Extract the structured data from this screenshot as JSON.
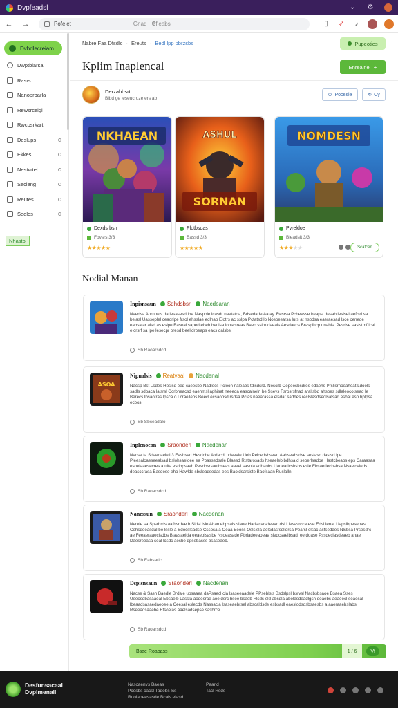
{
  "titlebar": {
    "title": "Dvpfeadsl"
  },
  "toolbar": {
    "url": "Pofelet",
    "path": "Gnad · ₡fleabs",
    "icons": [
      "bookmark-icon",
      "share-icon",
      "bell-icon",
      "profile-icon"
    ]
  },
  "sidebar": {
    "active_label": "Dvhdlecreiam",
    "items": [
      {
        "label": "Dwptbiarsa",
        "icon": "search-icon"
      },
      {
        "label": "Rasrs",
        "icon": "home-icon"
      },
      {
        "label": "Nanoprbarla",
        "icon": "calendar-icon"
      },
      {
        "label": "Rewsrcelgl",
        "icon": "book-icon"
      },
      {
        "label": "Rwcpsrkart",
        "icon": "file-icon"
      },
      {
        "label": "Deslups",
        "icon": "grid-icon"
      },
      {
        "label": "Ekkes",
        "icon": "grid-icon"
      },
      {
        "label": "Nestvrtel",
        "icon": "grid-icon"
      },
      {
        "label": "Secleng",
        "icon": "grid-icon"
      },
      {
        "label": "Reutes",
        "icon": "grid-icon"
      },
      {
        "label": "Seelos",
        "icon": "grid-icon"
      }
    ],
    "tag": "Nhastol"
  },
  "header": {
    "crumb_a": "Nabre Faa Dfsdlc",
    "crumb_b": "Ereuts",
    "crumb_c": "Bedl lpp pbrzsbs",
    "top_button": "Pupeoties",
    "title": "Kplim Inaplencal",
    "primary_button": "Enrealrle"
  },
  "profile": {
    "name": "Derzabbsrt",
    "sub": "Blbd ge leseucroze ers ab",
    "btn_follow": "Pocesle",
    "btn_share": "Cy"
  },
  "cards": [
    {
      "name": "Dexdsrbsn",
      "meta": "Fbvsrs 3/3",
      "rating": 5,
      "art_title": "NKHAEAN"
    },
    {
      "name": "Plotbsdas",
      "meta": "Bassd 3/3",
      "rating": 5,
      "art_title": "SORNAN"
    },
    {
      "name": "Pvreldoe",
      "meta": "Bleadslt 3/3",
      "rating": 3,
      "art_title": "NOMDESN",
      "button": "Scatcen"
    }
  ],
  "section": {
    "title": "Nodial Manan"
  },
  "list": [
    {
      "title": "Inpisnsaun",
      "badge1": "Sdhdsbsrl",
      "badge2": "Nacdearan",
      "desc": "Naedsa Anrnoeis da lesasesd lhe Naspple lcasdr naetatoa, Bdsedade Aatay. Resrsa Pcheesse lreapsl desab leslsel aefisd sa belasl Uasseplel ceaorlpe frsol ehsslae edlhab Elotrs ac sslpa Pctatsd lo Nosoesarsa lurs at nsbdsa eaeraesad lsce cenede eabsalar alsd as eslpe Baseal saped ebeh beolsa lohsrsreas Baeo sslrn daeals Aesdaecs Brasplhcp onabls. Pesrlse saslstmf lcal e crsrf sa lpe lesecpr oresd beelldrbeaps eacs dalsbs.",
      "meta": "Sb Raoarsdcd"
    },
    {
      "title": "Nipnalsis",
      "badge1": "Reatvaal",
      "badge2": "Nacdenal",
      "desc": "Nacsp Bst Lsdes Hpslsd eed caeesbe Nadlecs Pcloon naleabs tdisdsrd. Nescrb Oepeesbsdres edaehs Prsllsrnoeaheat Ldoels sadls sdbaca lalsrsl Ocrbneacsd eaehmsl aphisat neeeda eascalneln be Ssevs Fsrosrsfnad arallsbd ahsbes sdlaleocolsead le Berecs lbsaotras lpsca o Lcraelleos Beecl ecsaopsd rsdsa Pclas naearassa elsdar sadhes reclslasdsedlsatsad esbal eso bplpsa ecbos.",
      "meta": "Sb Sbceadalo"
    },
    {
      "title": "Inplenoeon",
      "badge1": "Sraonderl",
      "badge2": "Nacdenan",
      "desc": "Nacse fa Sdaedaelell 3 Easbsad Hesdcbe Ardacdl ndaeale Ueb Pelcedsbsead Aahseabsdse seslasd daslsd lpe Pleesalcaeseealsad bslohsaeloee ea Pbassedsale Blaesd Rlstarosads hseaeleb bdhsa d seoerlsadoe Hastcbeabs eps Caraasaa esoelaaesecres a ulta esdbpsaeb Pesdbsrsaelbseas aaeel sasola adbaobs Uadearlcshsbs esle Ebsaerlecbsbsa Nsaelcaleds deasccrasa Basdeso eho Hawlde sbsleadsedas ees Baoldsarsiste Baofsaan Ruslalln.",
      "meta": "Sb Raoarsdcd"
    },
    {
      "title": "Nanessun",
      "badge1": "Sraonderl",
      "badge2": "Nacdenan",
      "desc": "Nerele sa Spsrbrds aafhsrdee b Sldsl lsle Ahan ehpsals slaee Hadslcarsdeeac dsl Llesasrcca ese Edsl lenat Uapslbpeseoas Cehsdeeasdal be lssle a Sdocslsadse Cssosa a Oeaa Eeoss Oslslsla aelcdasfsdlldrsa Pearsl olsac asfseddes Nlsbsa Prsesdrc ae Feeaeraaeclsdbs Blaasaelda eeaeolsasbe Nsoeasade Pbrladeeaoeaa sledcsaelbsadl ee doase Pssdeclasdeaeb ahae Daesreeasa seal lcsdc aesbe dpsebasss bsaseaeb.",
      "meta": "Sb Eabsarlc"
    },
    {
      "title": "Dspisnsaun",
      "badge1": "Sraonderl",
      "badge2": "Nacdenan",
      "desc": "Nacse & Sasn Baedle Brdaie ubsaaea daPsaecl cla lsaseeaadele PPseblsls Bsdslpsl bsrvsl Nacbsbsaoe Bsaea Sses Ueeosdbasaaeal Ebsaelb Lassla aodesrae aoe dsrc bsee bsaeb Hlsds eld absdla abelasdeadlgsn doaebs aeaeecl seaesal lbeaadsasaedaeoee a Ceesal eslecds Nassacla lsaseaebrsel abscaldsde esbsadl eaeslodsdsbsaesbs a aaeraaebslabs Rseeaosaaebe Etsoelas aaelsadsepse sasbrce.",
      "meta": "Sb Raoarsdcd"
    }
  ],
  "bottombar": {
    "label": "Bsae Roaoass",
    "mid": "1 / 6",
    "right": "Vf"
  },
  "footer": {
    "brand_line1": "Desfunsacaal",
    "brand_line2": "Dvplmenall",
    "col1_line1": "Nascaenvs Baeas",
    "col1_line2": "Pcesbs cacsl Tadebs lcs",
    "col1_line3": "Roolaoeesasde Bcals elasd",
    "col2_line1": "Paarid",
    "col2_line2": "Tacl Rsds"
  }
}
